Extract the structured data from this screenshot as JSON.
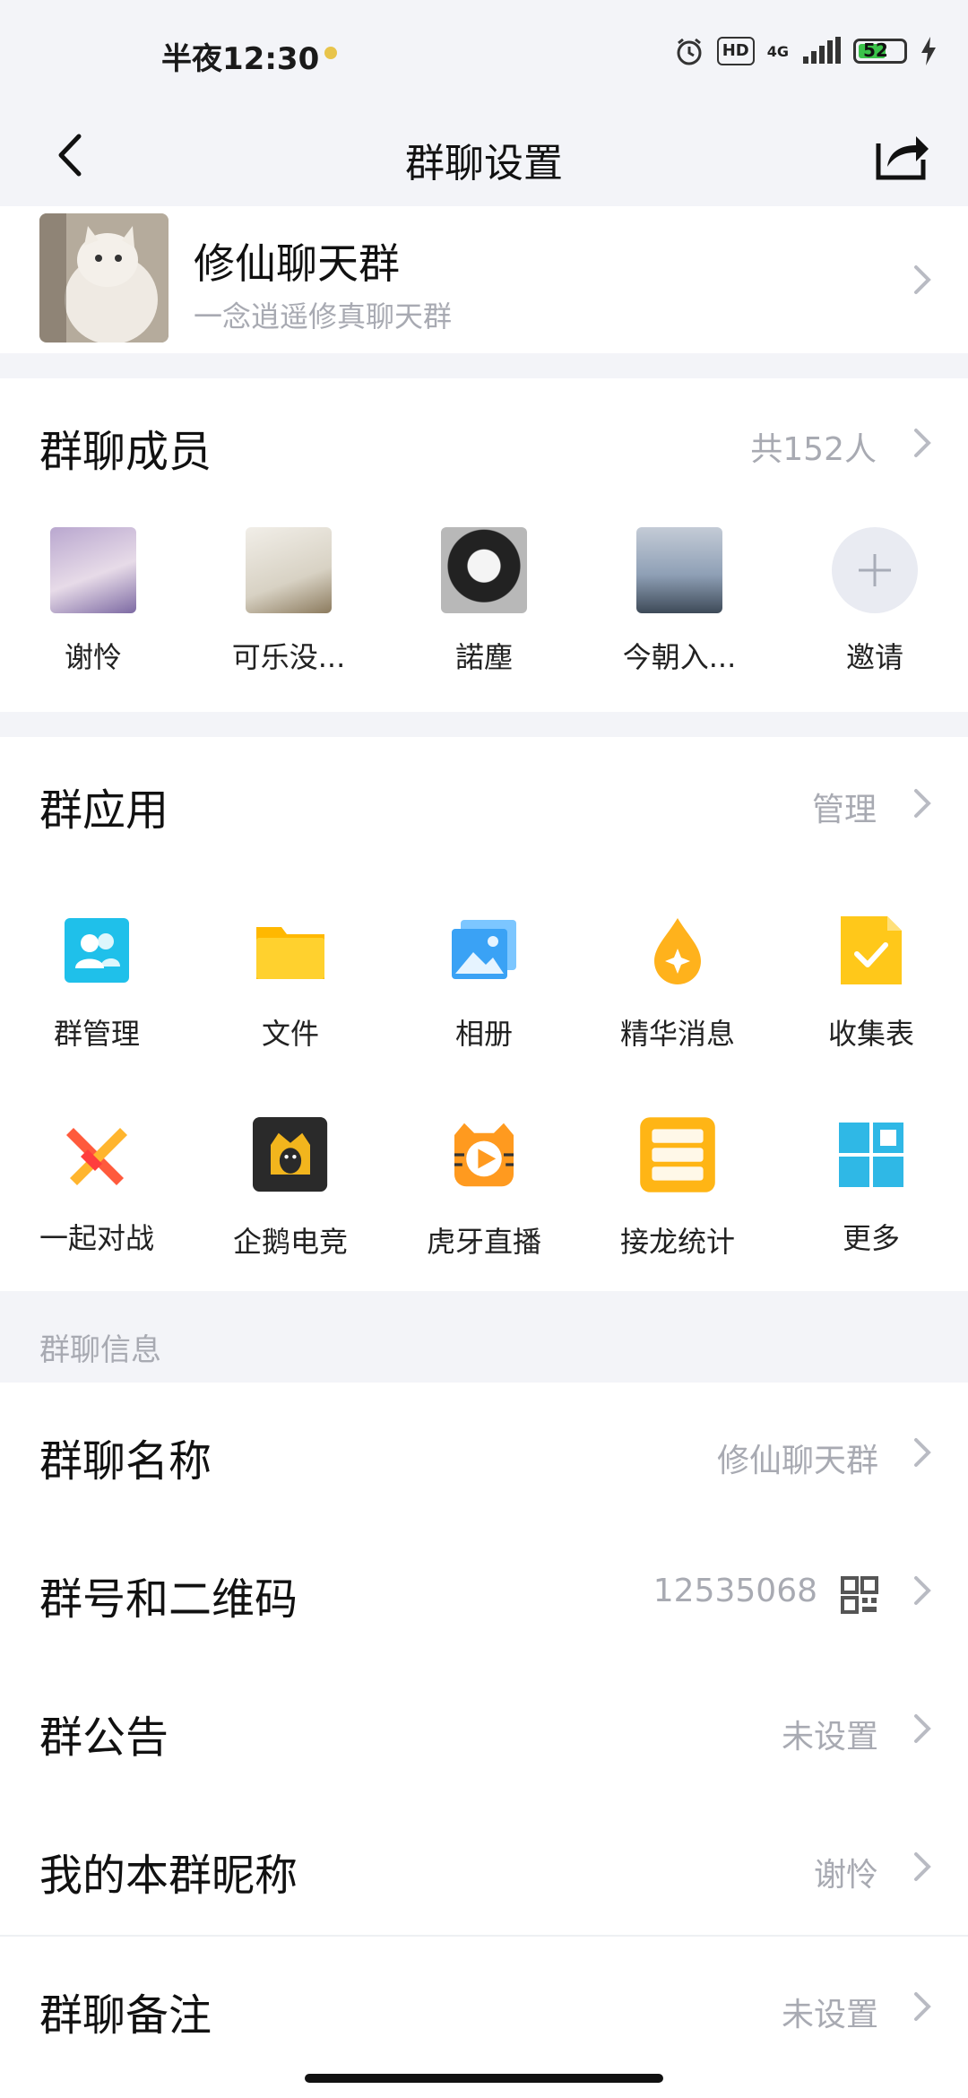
{
  "status_bar": {
    "time": "半夜12:30",
    "hd": "HD",
    "network": "4G",
    "battery": "52"
  },
  "nav": {
    "title": "群聊设置",
    "back_icon": "chevron-left-icon",
    "share_icon": "share-icon"
  },
  "group": {
    "name": "修仙聊天群",
    "description": "一念逍遥修真聊天群"
  },
  "members": {
    "title": "群聊成员",
    "count_text": "共152人",
    "list": [
      {
        "name": "谢怜",
        "color": "#c9b8d6"
      },
      {
        "name": "可乐没...",
        "color": "#e6e2d9"
      },
      {
        "name": "諾塵",
        "color": "#b8b8b8"
      },
      {
        "name": "今朝入...",
        "color": "#8fa0b6"
      }
    ],
    "invite_label": "邀请"
  },
  "apps": {
    "title": "群应用",
    "manage_label": "管理",
    "items": [
      {
        "label": "群管理",
        "icon": "group-manage-icon"
      },
      {
        "label": "文件",
        "icon": "folder-icon"
      },
      {
        "label": "相册",
        "icon": "album-icon"
      },
      {
        "label": "精华消息",
        "icon": "essence-drop-icon"
      },
      {
        "label": "收集表",
        "icon": "collect-form-icon"
      },
      {
        "label": "一起对战",
        "icon": "battle-icon"
      },
      {
        "label": "企鹅电竞",
        "icon": "penguin-esports-icon"
      },
      {
        "label": "虎牙直播",
        "icon": "huya-live-icon"
      },
      {
        "label": "接龙统计",
        "icon": "chain-stats-icon"
      },
      {
        "label": "更多",
        "icon": "more-grid-icon"
      }
    ]
  },
  "info": {
    "section_label": "群聊信息",
    "rows": [
      {
        "label": "群聊名称",
        "value": "修仙聊天群"
      },
      {
        "label": "群号和二维码",
        "value": "12535068"
      },
      {
        "label": "群公告",
        "value": "未设置"
      },
      {
        "label": "我的本群昵称",
        "value": "谢怜"
      },
      {
        "label": "群聊备注",
        "value": "未设置"
      }
    ]
  },
  "colors": {
    "accent_blue": "#1fb6f0",
    "folder_yellow": "#ffc21a",
    "chevron": "#b9bbc3"
  }
}
